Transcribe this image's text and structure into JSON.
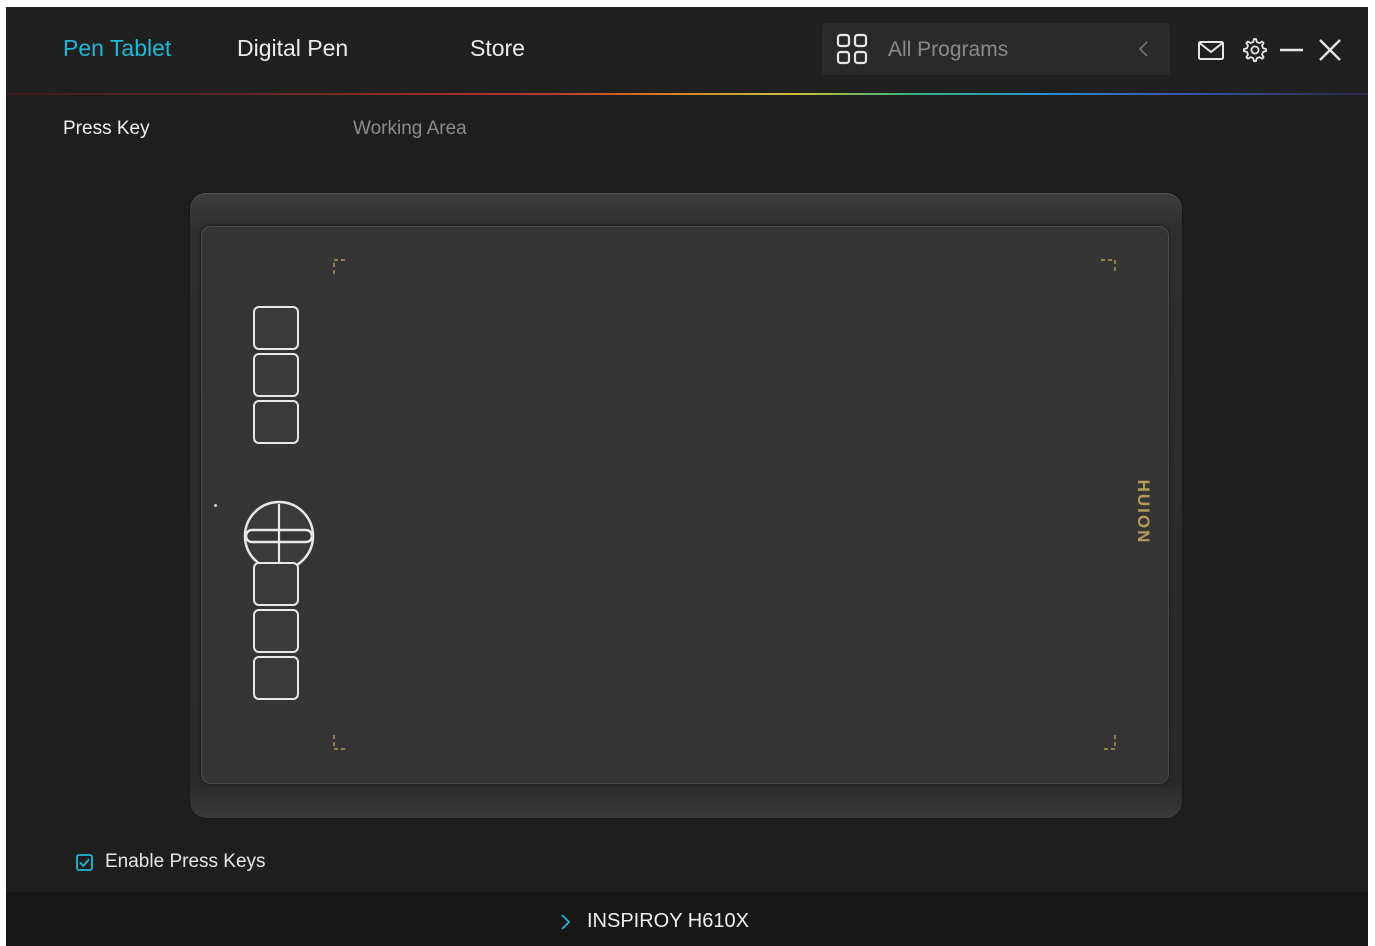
{
  "nav": {
    "tabs": [
      {
        "label": "Pen Tablet",
        "active": true
      },
      {
        "label": "Digital Pen",
        "active": false
      },
      {
        "label": "Store",
        "active": false
      }
    ]
  },
  "programs": {
    "label": "All Programs",
    "grid_icon": "grid-icon",
    "collapse_icon": "chevron-left-icon"
  },
  "window_controls": {
    "icons": [
      "mail-icon",
      "gear-icon",
      "minimize-icon",
      "close-icon"
    ]
  },
  "subtabs": [
    {
      "label": "Press Key",
      "active": true
    },
    {
      "label": "Working Area",
      "active": false
    }
  ],
  "tablet": {
    "brand": "HUION",
    "press_keys_top_count": 3,
    "press_keys_bottom_count": 3
  },
  "enable_press_keys": {
    "label": "Enable Press Keys",
    "checked": true
  },
  "device": {
    "name": "INSPIROY H610X"
  },
  "colors": {
    "accent": "#1fb7d6",
    "background": "#1e1e1e",
    "brand_gold": "#b79a5a"
  }
}
